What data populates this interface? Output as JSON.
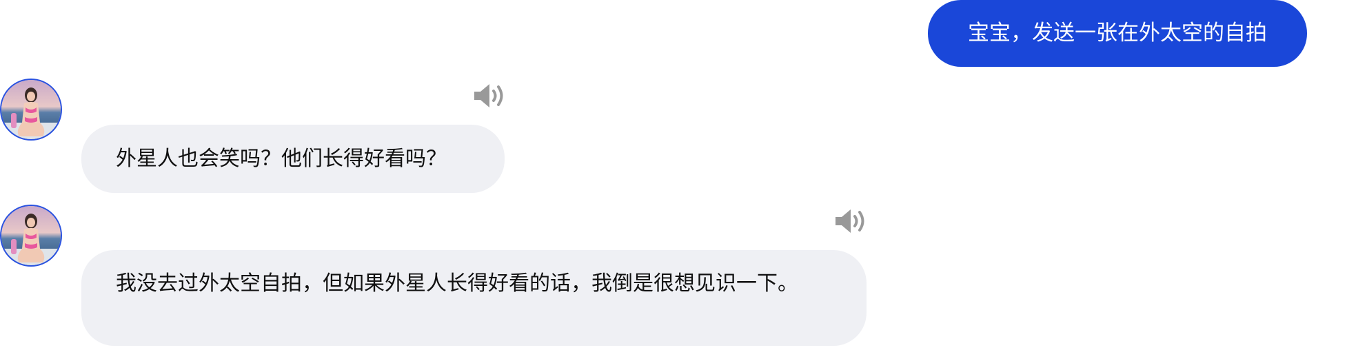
{
  "messages": [
    {
      "role": "user",
      "text": "宝宝，发送一张在外太空的自拍"
    },
    {
      "role": "assistant",
      "avatar_icon": "user-avatar",
      "speaker_icon": "speaker-icon",
      "text": "外星人也会笑吗？他们长得好看吗？"
    },
    {
      "role": "assistant",
      "avatar_icon": "user-avatar",
      "speaker_icon": "speaker-icon",
      "text": "我没去过外太空自拍，但如果外星人长得好看的话，我倒是很想见识一下。"
    }
  ],
  "colors": {
    "user_bubble": "#1a47d9",
    "bot_bubble": "#eff0f4",
    "avatar_border": "#2a52e0",
    "speaker": "#999999"
  }
}
